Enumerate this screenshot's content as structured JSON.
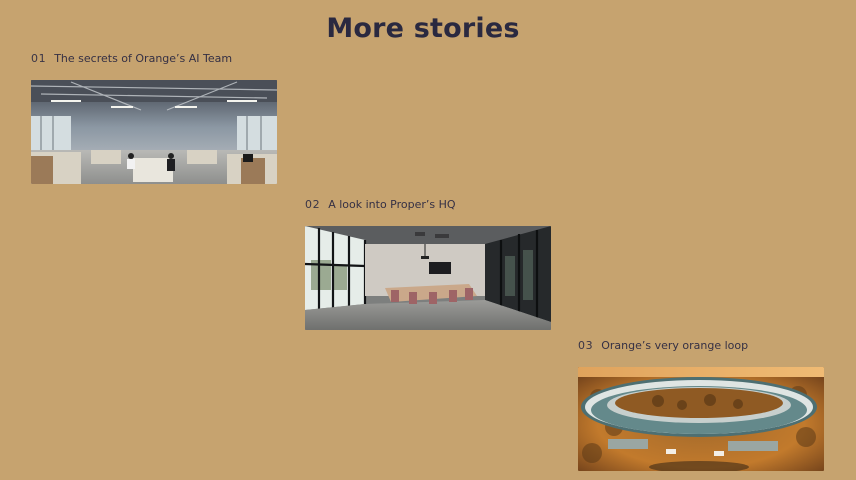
{
  "heading": "More stories",
  "stories": [
    {
      "number": "01",
      "title": "The secrets of Orange’s AI Team",
      "image_icon": "office-photo"
    },
    {
      "number": "02",
      "title": "A look into Proper’s HQ",
      "image_icon": "meeting-room-photo"
    },
    {
      "number": "03",
      "title": "Orange’s very orange loop",
      "image_icon": "ring-campus-photo"
    }
  ],
  "colors": {
    "background": "#c6a36f",
    "heading": "#2a2940",
    "text": "#353044"
  }
}
